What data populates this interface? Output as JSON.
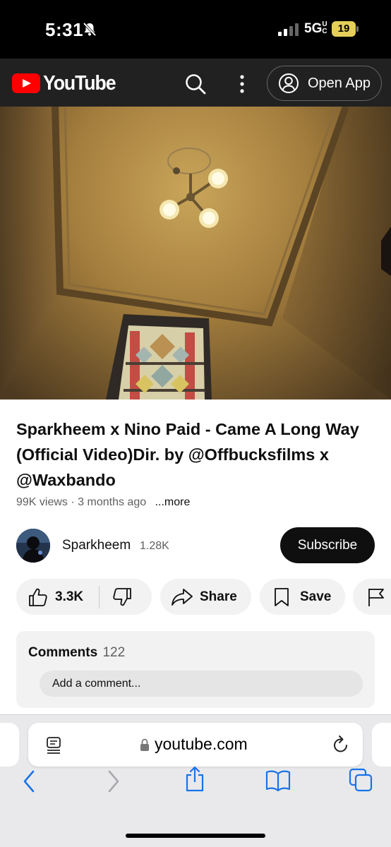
{
  "status_bar": {
    "time": "5:31",
    "network": "5G",
    "network_sup": "UC",
    "battery": "19",
    "battery_color": "#e5cf5a"
  },
  "header": {
    "logo_text": "YouTube",
    "open_app_label": "Open App",
    "brand_color": "#ff0000"
  },
  "video": {
    "title": "Sparkheem x Nino Paid - Came A Long Way (Official Video)Dir. by @Offbucksfilms x @Waxbando",
    "views": "99K views",
    "age": "3 months ago",
    "more_label": "...more"
  },
  "channel": {
    "name": "Sparkheem",
    "subscribers": "1.28K",
    "subscribe_label": "Subscribe"
  },
  "actions": {
    "likes": "3.3K",
    "share_label": "Share",
    "save_label": "Save"
  },
  "comments": {
    "heading": "Comments",
    "count": "122",
    "placeholder": "Add a comment..."
  },
  "browser": {
    "url": "youtube.com",
    "accent": "#1a73e8"
  }
}
